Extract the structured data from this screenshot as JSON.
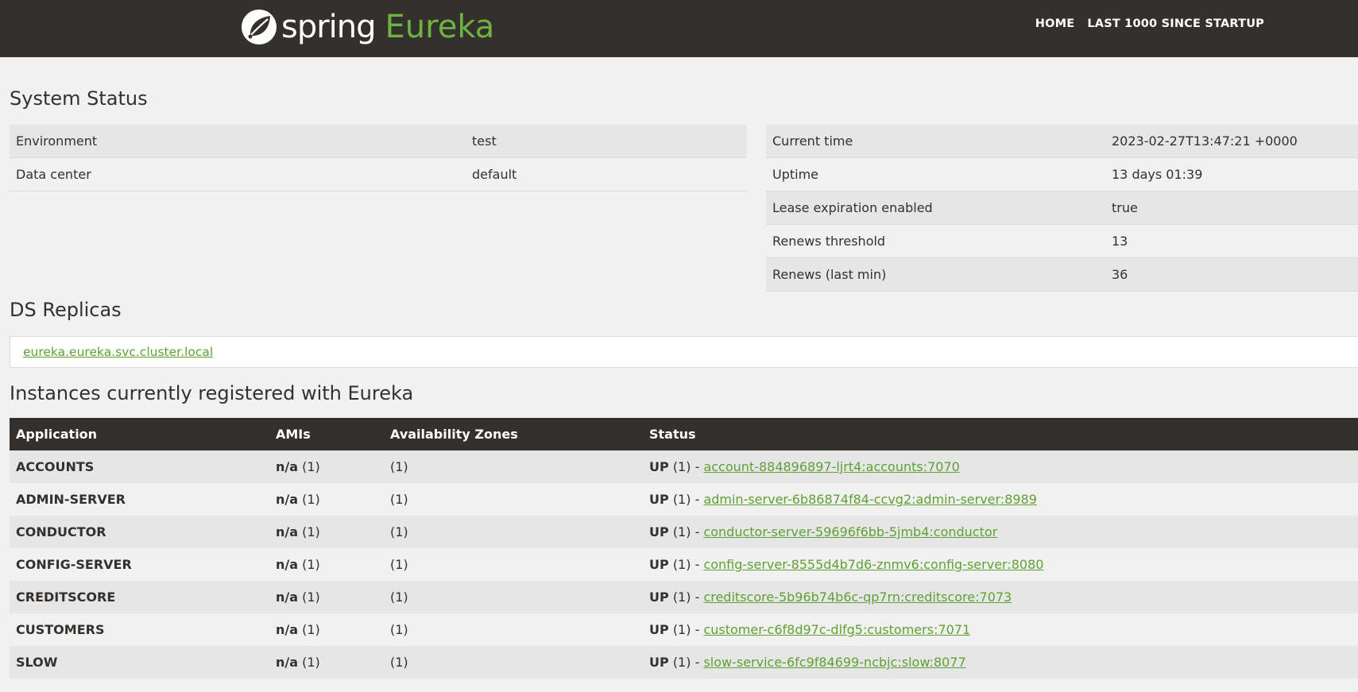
{
  "brand": {
    "spring": "spring",
    "eureka": "Eureka"
  },
  "nav": {
    "home": "HOME",
    "last1000": "LAST 1000 SINCE STARTUP"
  },
  "system_status": {
    "title": "System Status",
    "left": [
      {
        "key": "Environment",
        "value": "test"
      },
      {
        "key": "Data center",
        "value": "default"
      }
    ],
    "right": [
      {
        "key": "Current time",
        "value": "2023-02-27T13:47:21 +0000"
      },
      {
        "key": "Uptime",
        "value": "13 days 01:39"
      },
      {
        "key": "Lease expiration enabled",
        "value": "true"
      },
      {
        "key": "Renews threshold",
        "value": "13"
      },
      {
        "key": "Renews (last min)",
        "value": "36"
      }
    ]
  },
  "ds_replicas": {
    "title": "DS Replicas",
    "link": "eureka.eureka.svc.cluster.local"
  },
  "instances": {
    "title": "Instances currently registered with Eureka",
    "headers": {
      "application": "Application",
      "amis": "AMIs",
      "zones": "Availability Zones",
      "status": "Status"
    },
    "rows": [
      {
        "application": "ACCOUNTS",
        "ami_label": "n/a",
        "ami_count": "(1)",
        "zones": "(1)",
        "status": "UP",
        "status_count": "(1) -",
        "instance": "account-884896897-ljrt4:accounts:7070"
      },
      {
        "application": "ADMIN-SERVER",
        "ami_label": "n/a",
        "ami_count": "(1)",
        "zones": "(1)",
        "status": "UP",
        "status_count": "(1) -",
        "instance": "admin-server-6b86874f84-ccvg2:admin-server:8989"
      },
      {
        "application": "CONDUCTOR",
        "ami_label": "n/a",
        "ami_count": "(1)",
        "zones": "(1)",
        "status": "UP",
        "status_count": "(1) -",
        "instance": "conductor-server-59696f6bb-5jmb4:conductor"
      },
      {
        "application": "CONFIG-SERVER",
        "ami_label": "n/a",
        "ami_count": "(1)",
        "zones": "(1)",
        "status": "UP",
        "status_count": "(1) -",
        "instance": "config-server-8555d4b7d6-znmv6:config-server:8080"
      },
      {
        "application": "CREDITSCORE",
        "ami_label": "n/a",
        "ami_count": "(1)",
        "zones": "(1)",
        "status": "UP",
        "status_count": "(1) -",
        "instance": "creditscore-5b96b74b6c-qp7rn:creditscore:7073"
      },
      {
        "application": "CUSTOMERS",
        "ami_label": "n/a",
        "ami_count": "(1)",
        "zones": "(1)",
        "status": "UP",
        "status_count": "(1) -",
        "instance": "customer-c6f8d97c-dlfg5:customers:7071"
      },
      {
        "application": "SLOW",
        "ami_label": "n/a",
        "ami_count": "(1)",
        "zones": "(1)",
        "status": "UP",
        "status_count": "(1) -",
        "instance": "slow-service-6fc9f84699-ncbjc:slow:8077"
      }
    ]
  },
  "colors": {
    "header_bg": "#34302d",
    "accent_green": "#6db33f",
    "link_green": "#5fa134"
  },
  "icons": {
    "brand_logo": "spring-leaf-icon"
  }
}
